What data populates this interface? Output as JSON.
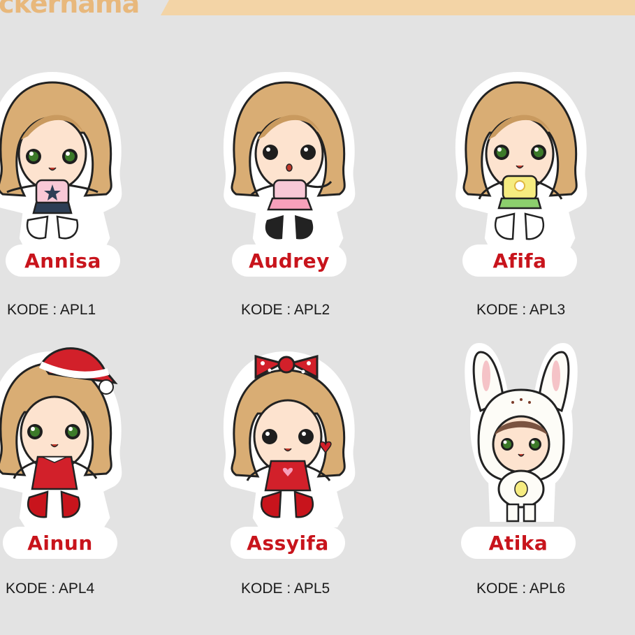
{
  "brand": {
    "text": "ckernama"
  },
  "colors": {
    "banner": "#f3d4a6",
    "name_red": "#c8141c",
    "hair": "#d9ad74",
    "background": "#e3e3e3"
  },
  "items": [
    {
      "name": "Annisa",
      "code": "KODE : APL1",
      "variant": "star-shirt"
    },
    {
      "name": "Audrey",
      "code": "KODE : APL2",
      "variant": "pink-dress"
    },
    {
      "name": "Afifa",
      "code": "KODE : APL3",
      "variant": "flower-shirt"
    },
    {
      "name": "Ainun",
      "code": "KODE : APL4",
      "variant": "santa-hat"
    },
    {
      "name": "Assyifa",
      "code": "KODE : APL5",
      "variant": "polka-bow"
    },
    {
      "name": "Atika",
      "code": "KODE : APL6",
      "variant": "bunny-costume"
    }
  ]
}
